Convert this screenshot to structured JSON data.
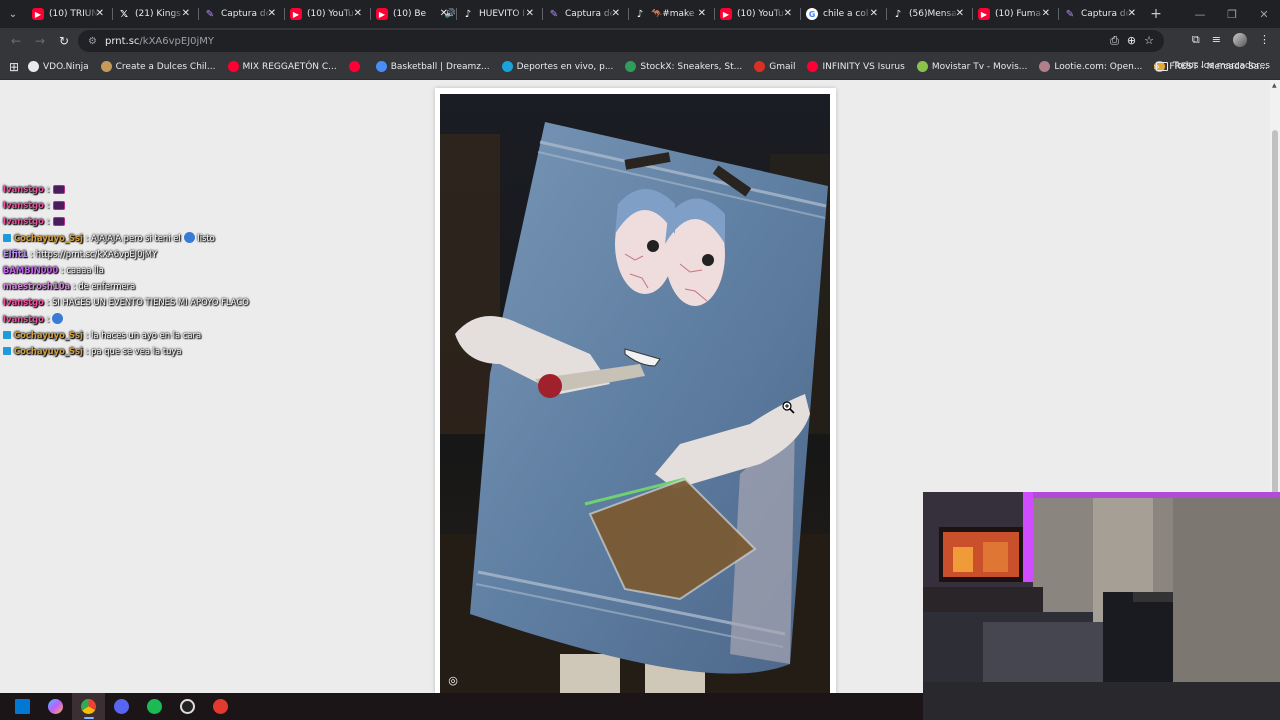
{
  "tabs": [
    {
      "icon": "youtube",
      "title": "(10) TRIUN"
    },
    {
      "icon": "x",
      "title": "(21) Kings"
    },
    {
      "icon": "pen",
      "title": "Captura de"
    },
    {
      "icon": "youtube",
      "title": "(10) YouTu"
    },
    {
      "icon": "youtube",
      "title": "(10) Be",
      "audio": "🔊"
    },
    {
      "icon": "tiktok",
      "title": "HUEVITO I"
    },
    {
      "icon": "pen",
      "title": "Captura de"
    },
    {
      "icon": "tiktok",
      "title": "🦘#make"
    },
    {
      "icon": "youtube",
      "title": "(10) YouTu"
    },
    {
      "icon": "google",
      "title": "chile a col"
    },
    {
      "icon": "tiktok",
      "title": "(56)Mensa"
    },
    {
      "icon": "youtube",
      "title": "(10) Fuma"
    },
    {
      "icon": "pen",
      "title": "Captura de"
    }
  ],
  "new_tab": "+",
  "url": {
    "host": "prnt.sc",
    "path": "/kXA6vpEJ0jMY"
  },
  "bookmarks": [
    {
      "label": "VDO.Ninja",
      "color": "#e8eaed"
    },
    {
      "label": "Create a Dulces Chil...",
      "color": "#c89a5a"
    },
    {
      "label": "MIX REGGAETÓN C...",
      "color": "#ff0033"
    },
    {
      "label": "",
      "color": "#ff0033"
    },
    {
      "label": "Basketball | Dreamz...",
      "color": "#4a8df6"
    },
    {
      "label": "Deportes en vivo, p...",
      "color": "#1aa3d8"
    },
    {
      "label": "StockX: Sneakers, St...",
      "color": "#2e9e5a"
    },
    {
      "label": "Gmail",
      "color": "#d93025"
    },
    {
      "label": "INFINITY VS Isurus",
      "color": "#ff0033"
    },
    {
      "label": "Movistar Tv - Movis...",
      "color": "#8bc34a"
    },
    {
      "label": "Lootie.com: Open...",
      "color": "#b07f8c"
    },
    {
      "label": "FREST - Mercado Sa...",
      "color": "#e8a838"
    }
  ],
  "bookmarks_all": "Todos los marcadores",
  "chat": [
    {
      "user": "Ivanstgo",
      "color": "#f04fa0",
      "text": ":",
      "badge": false,
      "emote": true
    },
    {
      "user": "Ivanstgo",
      "color": "#f04fa0",
      "text": ":",
      "badge": false,
      "emote": true
    },
    {
      "user": "Ivanstgo",
      "color": "#f04fa0",
      "text": ":",
      "badge": false,
      "emote": true
    },
    {
      "user": "Cochayuyo_Ssj",
      "color": "#d4a03a",
      "text": ": AJAJAJA pero si teni el",
      "text2": "listo",
      "badge": true,
      "emote2": true
    },
    {
      "user": "Elfit1",
      "color": "#b48be8",
      "text": ": https://prnt.sc/kXA6vpEJ0jMY",
      "badge": false
    },
    {
      "user": "BAMBIN000",
      "color": "#c65cf0",
      "text": ": caaaa lla",
      "badge": false
    },
    {
      "user": "maestrosh10a",
      "color": "#c98ad0",
      "text": ": de enfermera",
      "badge": false
    },
    {
      "user": "Ivanstgo",
      "color": "#f04fa0",
      "text": ": SI HACES UN EVENTO TIENES MI APOYO FLACO",
      "badge": false
    },
    {
      "user": "Ivanstgo",
      "color": "#f04fa0",
      "text": ":",
      "badge": false,
      "emote2": true
    },
    {
      "user": "Cochayuyo_Ssj",
      "color": "#d4a03a",
      "text": ": la haces un ayo en la cara",
      "badge": true
    },
    {
      "user": "Cochayuyo_Ssj",
      "color": "#d4a03a",
      "text": ": pa que se vea la tuya",
      "badge": true
    }
  ],
  "taskbar": [
    "windows",
    "copilot",
    "chrome",
    "discord",
    "spotify",
    "obs",
    "record"
  ]
}
